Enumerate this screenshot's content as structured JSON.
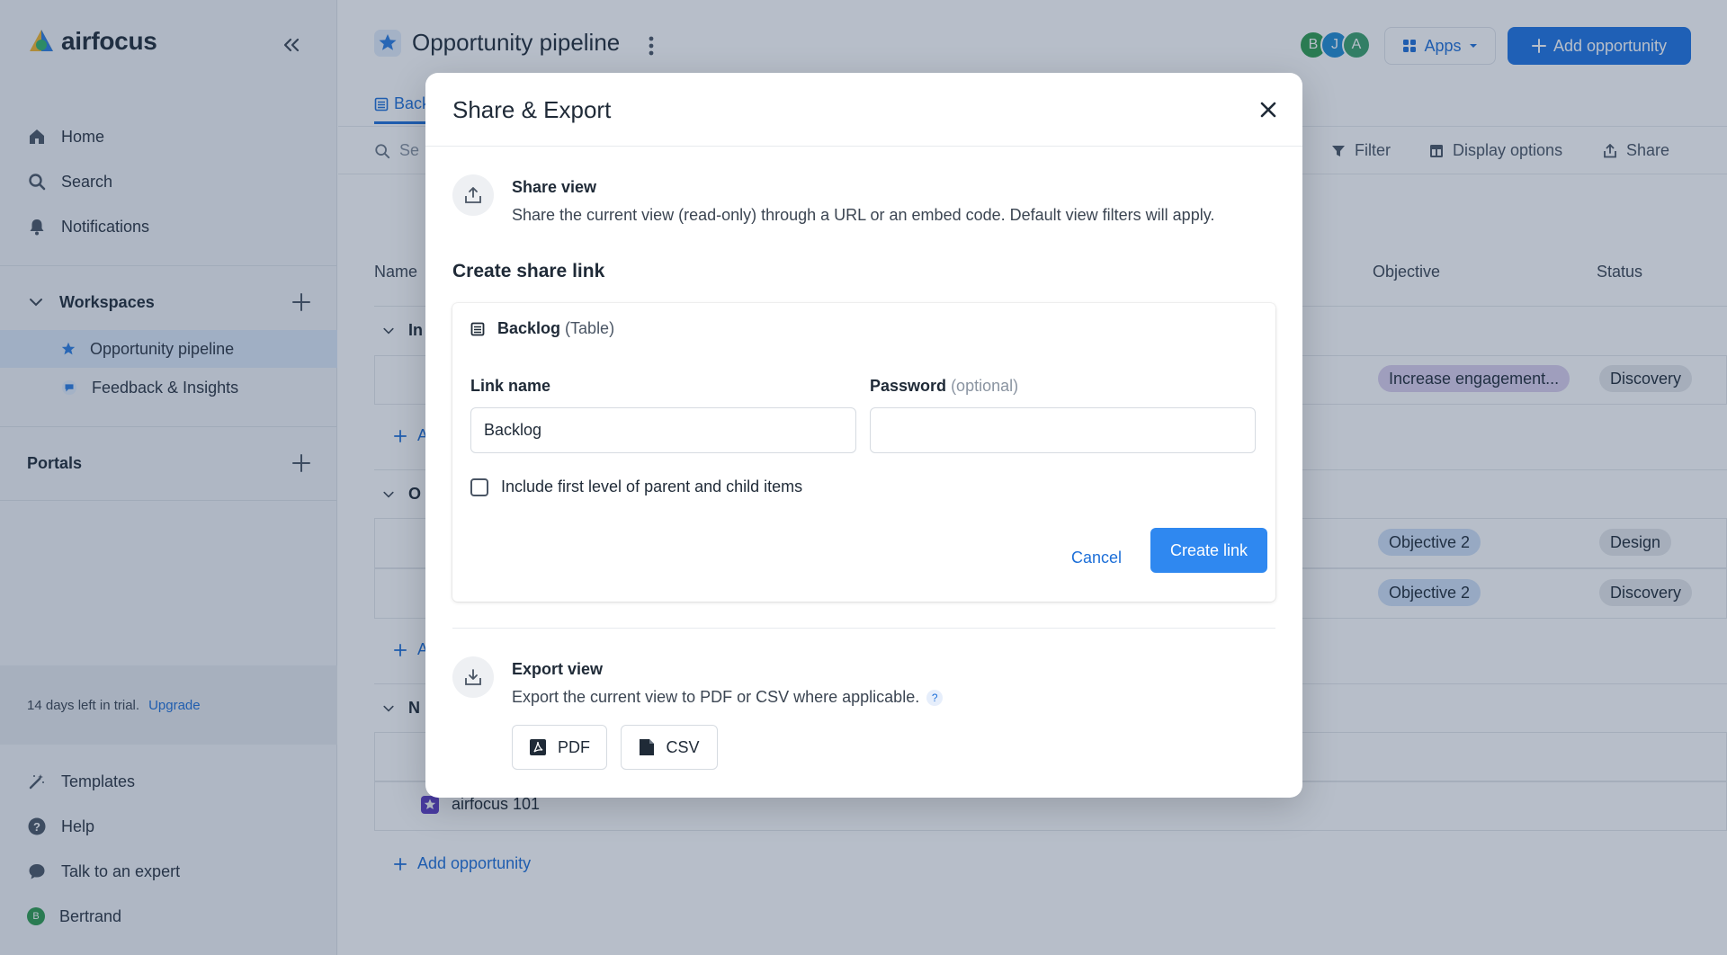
{
  "brand": {
    "name": "airfocus"
  },
  "sidebar": {
    "nav": [
      {
        "label": "Home",
        "icon": "home-icon"
      },
      {
        "label": "Search",
        "icon": "search-icon"
      },
      {
        "label": "Notifications",
        "icon": "bell-icon"
      }
    ],
    "workspaces": {
      "title": "Workspaces",
      "items": [
        {
          "label": "Opportunity pipeline",
          "icon": "star-icon",
          "active": true
        },
        {
          "label": "Feedback & Insights",
          "icon": "chat-bubble-icon",
          "active": false
        }
      ]
    },
    "portals": {
      "title": "Portals"
    },
    "trial": {
      "text": "14 days left in trial.",
      "link": "Upgrade"
    },
    "bottom": [
      {
        "label": "Templates",
        "icon": "magic-wand-icon"
      },
      {
        "label": "Help",
        "icon": "help-circle-icon"
      },
      {
        "label": "Talk to an expert",
        "icon": "chat-icon"
      },
      {
        "label": "Bertrand",
        "icon": "user-avatar",
        "initial": "B"
      }
    ]
  },
  "header": {
    "title": "Opportunity pipeline",
    "avatars": [
      "B",
      "J",
      "A"
    ],
    "apps_label": "Apps",
    "add_opportunity_label": "Add opportunity",
    "tab_label": "Back",
    "search_placeholder": "Se",
    "filter_label": "Filter",
    "display_options_label": "Display options",
    "share_label": "Share"
  },
  "table": {
    "columns": {
      "name": "Name",
      "objective": "Objective",
      "status": "Status"
    },
    "groups": [
      "In",
      "O",
      "N"
    ],
    "rows": [
      {
        "objective": "Increase engagement...",
        "status": "Discovery"
      },
      {
        "objective": "Objective 2",
        "status": "Design"
      },
      {
        "objective": "Objective 2",
        "status": "Discovery"
      }
    ],
    "add_short": "A",
    "last_item": "airfocus 101",
    "add_label": "Add opportunity"
  },
  "modal": {
    "title": "Share & Export",
    "share_view": {
      "title": "Share view",
      "description": "Share the current view (read-only) through a URL or an embed code. Default view filters will apply."
    },
    "create_title": "Create share link",
    "view_name": "Backlog",
    "view_type": "(Table)",
    "link_name_label": "Link name",
    "link_name_value": "Backlog",
    "password_label": "Password",
    "password_optional": "(optional)",
    "password_value": "",
    "checkbox_label": "Include first level of parent and child items",
    "cancel_label": "Cancel",
    "create_label": "Create link",
    "export_view": {
      "title": "Export view",
      "description": "Export the current view to PDF or CSV where applicable.",
      "help": "?"
    },
    "pdf_label": "PDF",
    "csv_label": "CSV"
  },
  "colors": {
    "accent": "#1d74e3",
    "active_bg": "#dde9f8",
    "purple_pill": "#dcd0ee",
    "blue_pill": "#cfe0f7",
    "gray_pill": "#e6e8eb"
  }
}
